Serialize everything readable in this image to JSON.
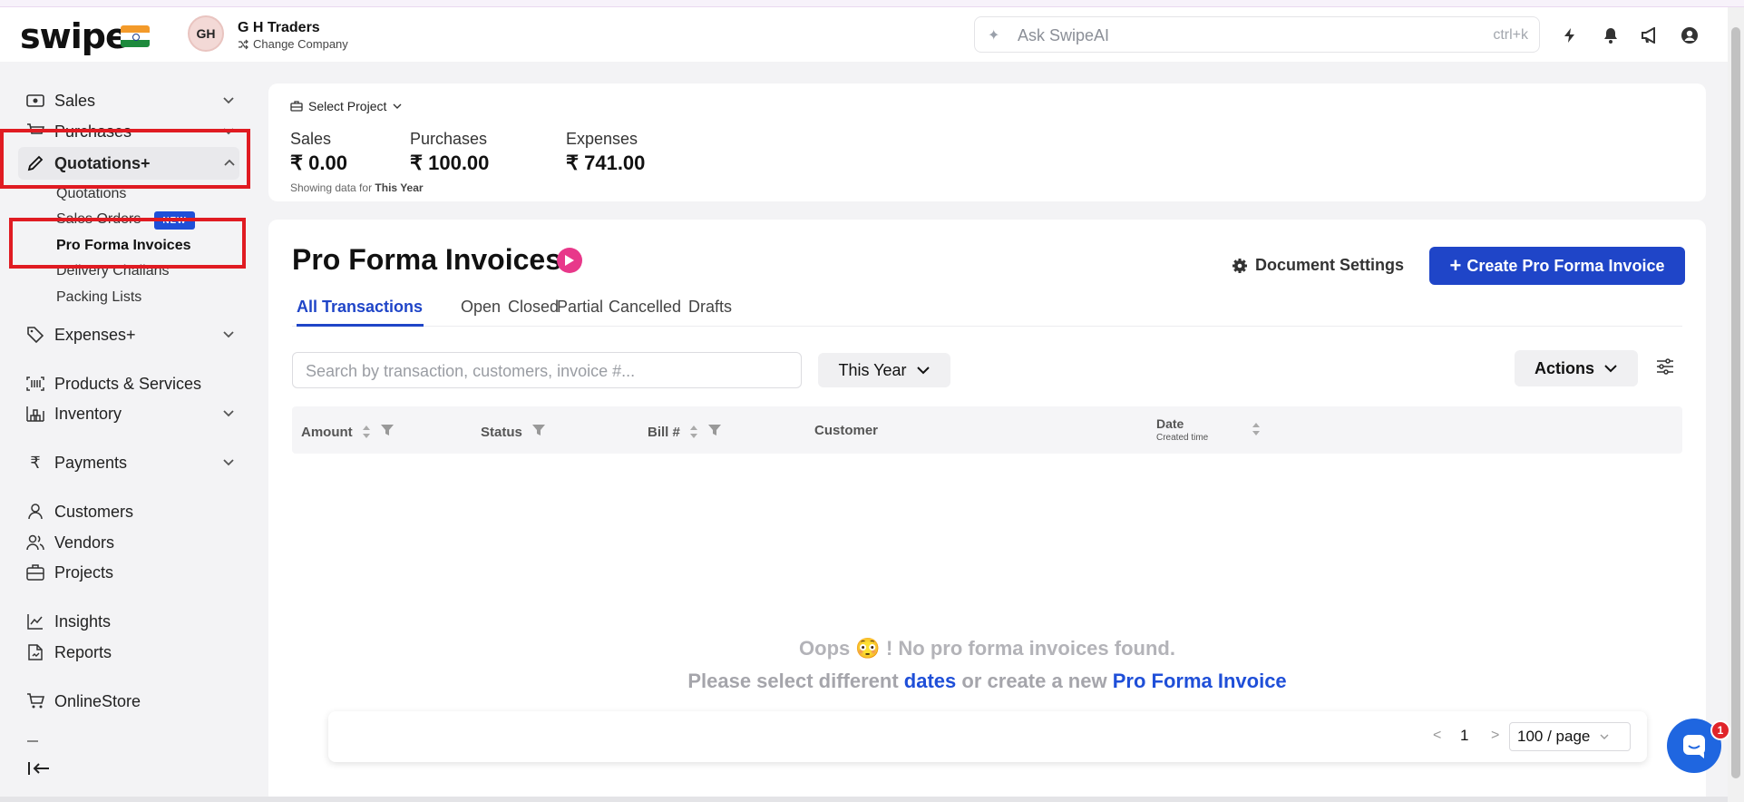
{
  "header": {
    "logo": "swipe",
    "avatar_initials": "GH",
    "company_name": "G H Traders",
    "change_company": "Change Company",
    "ask_placeholder": "Ask SwipeAI",
    "shortcut": "ctrl+k"
  },
  "sidebar": {
    "sales": "Sales",
    "purchases": "Purchases",
    "quotations": "Quotations+",
    "sub_quotations": "Quotations",
    "sub_sales_orders": "Sales Orders",
    "new_badge": "NEW",
    "sub_pro_forma": "Pro Forma Invoices",
    "sub_delivery": "Delivery Challans",
    "sub_packing": "Packing Lists",
    "expenses": "Expenses+",
    "products": "Products & Services",
    "inventory": "Inventory",
    "payments": "Payments",
    "customers": "Customers",
    "vendors": "Vendors",
    "projects": "Projects",
    "insights": "Insights",
    "reports": "Reports",
    "online_store": "OnlineStore"
  },
  "stats": {
    "select_project": "Select Project",
    "sales_label": "Sales",
    "sales_value": "₹ 0.00",
    "purchases_label": "Purchases",
    "purchases_value": "₹ 100.00",
    "expenses_label": "Expenses",
    "expenses_value": "₹ 741.00",
    "showing_prefix": "Showing data for",
    "showing_period": "This Year"
  },
  "main": {
    "title": "Pro Forma Invoices",
    "document_settings": "Document Settings",
    "create_button": "Create Pro Forma Invoice",
    "tabs": [
      "All Transactions",
      "Open",
      "Closed",
      "Partial",
      "Cancelled",
      "Drafts"
    ],
    "search_placeholder": "Search by transaction, customers, invoice #...",
    "period": "This Year",
    "actions": "Actions",
    "columns": {
      "amount": "Amount",
      "status": "Status",
      "bill": "Bill #",
      "customer": "Customer",
      "date": "Date",
      "date_sub": "Created time"
    },
    "empty_line1_a": "Oops",
    "empty_emoji": "😳",
    "empty_line1_b": "! No pro forma invoices found.",
    "empty_line2_a": "Please select different",
    "empty_link_dates": "dates",
    "empty_line2_b": "or create a new",
    "empty_link_create": "Pro Forma Invoice",
    "page_number": "1",
    "page_size": "100 / page"
  },
  "chat_badge": "1",
  "colors": {
    "accent": "#1f45c8",
    "highlight_box": "#e01b22",
    "play": "#e8388a"
  }
}
